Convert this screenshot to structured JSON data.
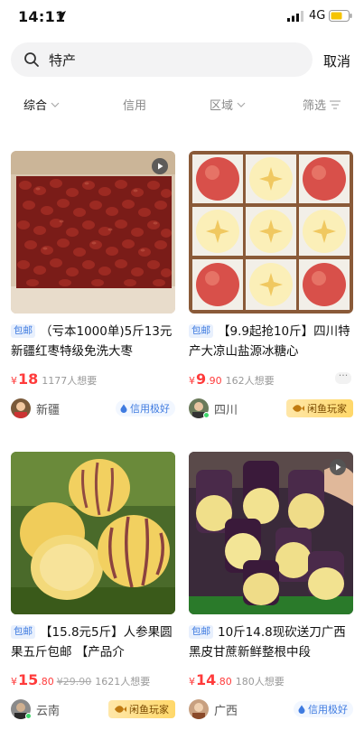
{
  "status": {
    "time": "14:11",
    "network": "4G"
  },
  "search": {
    "query": "特产",
    "cancel_label": "取消"
  },
  "filters": [
    {
      "label": "综合"
    },
    {
      "label": "信用"
    },
    {
      "label": "区域"
    },
    {
      "label": "筛选"
    }
  ],
  "items": [
    {
      "badge": "包邮",
      "title": "（亏本1000单)5斤13元新疆红枣特级免洗大枣",
      "price_symbol": "¥",
      "price_int": "18",
      "price_dec": "",
      "orig_price": "",
      "wants": "1177人想要",
      "location": "新疆",
      "seller_badge": "信用极好"
    },
    {
      "badge": "包邮",
      "title": "【9.9起抢10斤】四川特产大凉山盐源冰糖心",
      "price_symbol": "¥",
      "price_int": "9",
      "price_dec": ".90",
      "orig_price": "",
      "wants": "162人想要",
      "location": "四川",
      "seller_badge": "闲鱼玩家"
    },
    {
      "badge": "包邮",
      "title": "【15.8元5斤】人参果圆果五斤包邮 【产品介",
      "price_symbol": "¥",
      "price_int": "15",
      "price_dec": ".80",
      "orig_price": "¥29.90",
      "wants": "1621人想要",
      "location": "云南",
      "seller_badge": "闲鱼玩家"
    },
    {
      "badge": "包邮",
      "title": "10斤14.8现砍送刀广西黑皮甘蔗新鲜整根中段",
      "price_symbol": "¥",
      "price_int": "14",
      "price_dec": ".80",
      "orig_price": "",
      "wants": "180人想要",
      "location": "广西",
      "seller_badge": "信用极好"
    }
  ],
  "colors": {
    "price": "#ff3b3b",
    "badge_blue": "#3f7be0",
    "player_gold": "#ffd86a"
  },
  "icons": [
    "location-arrow-icon",
    "signal-icon",
    "battery-icon",
    "search-icon",
    "chevron-down-icon",
    "filter-icon",
    "video-play-icon",
    "more-icon",
    "credit-drop-icon",
    "fish-icon"
  ]
}
